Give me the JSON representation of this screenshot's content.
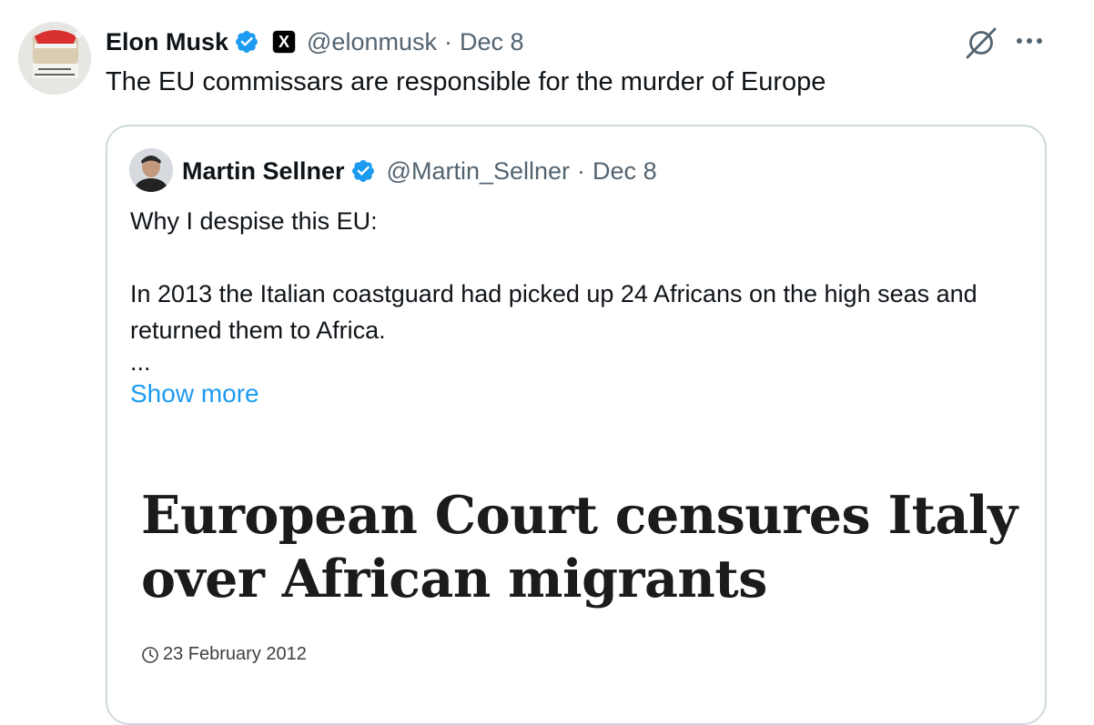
{
  "tweet": {
    "author_name": "Elon Musk",
    "handle": "@elonmusk",
    "separator": "·",
    "date": "Dec 8",
    "badge_letter": "X",
    "text": "The EU commissars are responsible for the murder of Europe"
  },
  "quoted_tweet": {
    "author_name": "Martin Sellner",
    "handle": "@Martin_Sellner",
    "separator": "·",
    "date": "Dec 8",
    "line1": "Why I despise this EU:",
    "line2": "In 2013 the Italian coastguard had picked up 24 Africans on the high seas and returned them to Africa.",
    "ellipsis": "...",
    "show_more": "Show more",
    "article": {
      "headline": "European Court censures Italy over African migrants",
      "date": "23 February 2012"
    }
  },
  "colors": {
    "accent": "#1d9bf0",
    "secondary_text": "#536471",
    "border": "#cfd9de"
  },
  "icons": [
    "verified-badge-icon",
    "x-logo-icon",
    "grok-icon",
    "more-options-icon",
    "clock-icon"
  ]
}
